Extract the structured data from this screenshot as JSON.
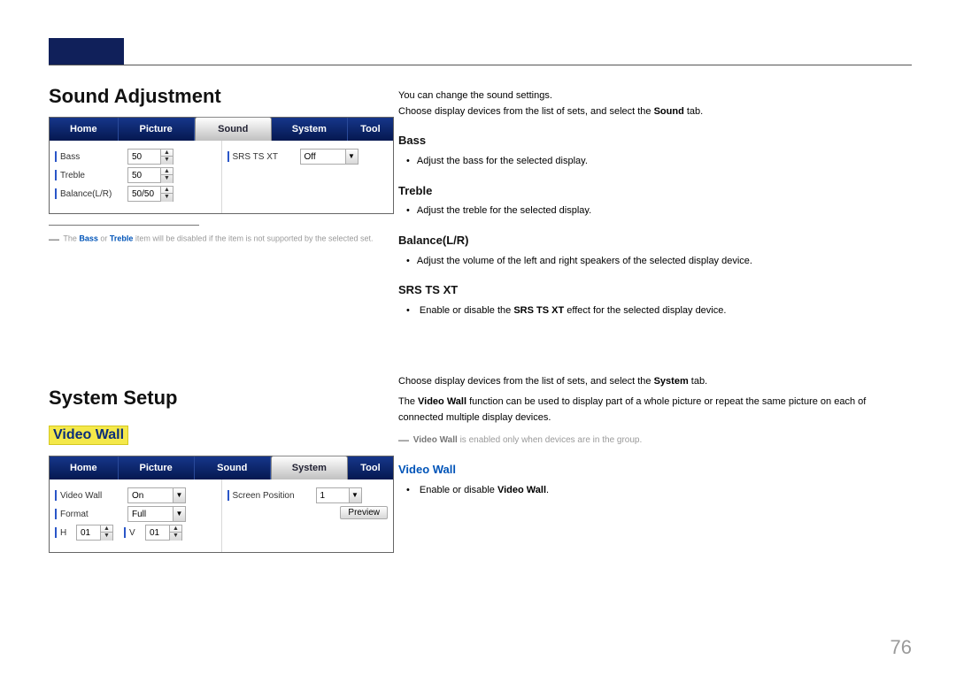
{
  "header": {
    "sound_title": "Sound Adjustment",
    "system_title": "System Setup",
    "video_wall_highlight": "Video Wall"
  },
  "tabs": {
    "home": "Home",
    "picture": "Picture",
    "sound": "Sound",
    "system": "System",
    "tool": "Tool"
  },
  "sound_ui": {
    "bass_label": "Bass",
    "bass_value": "50",
    "treble_label": "Treble",
    "treble_value": "50",
    "balance_label": "Balance(L/R)",
    "balance_value": "50/50",
    "srs_label": "SRS TS XT",
    "srs_value": "Off"
  },
  "system_ui": {
    "video_wall_label": "Video Wall",
    "video_wall_value": "On",
    "format_label": "Format",
    "format_value": "Full",
    "h_label": "H",
    "h_value": "01",
    "v_label": "V",
    "v_value": "01",
    "screen_pos_label": "Screen Position",
    "screen_pos_value": "1",
    "preview_label": "Preview"
  },
  "notes": {
    "sound_note_prefix": "The ",
    "sound_note_bass": "Bass",
    "sound_note_or": " or ",
    "sound_note_treble": "Treble",
    "sound_note_suffix": " item will be disabled if the item is not supported by the selected set.",
    "vw_note_prefix": "",
    "vw_note_bold": "Video Wall",
    "vw_note_suffix": " is enabled only when devices are in the group."
  },
  "right": {
    "intro1": "You can change the sound settings.",
    "intro2a": "Choose display devices from the list of sets, and select the ",
    "intro2b": "Sound",
    "intro2c": " tab.",
    "bass_h": "Bass",
    "bass_b": "Adjust the bass for the selected display.",
    "treble_h": "Treble",
    "treble_b": "Adjust the treble for the selected display.",
    "balance_h": "Balance(L/R)",
    "balance_b": "Adjust the volume of the left and right speakers of the selected display device.",
    "srs_h": "SRS TS XT",
    "srs_b1": "Enable or disable the ",
    "srs_b2": "SRS TS XT",
    "srs_b3": " effect for the selected display device.",
    "sys_intro_a": "Choose display devices from the list of sets, and select the ",
    "sys_intro_b": "System",
    "sys_intro_c": " tab.",
    "sys_desc_a": "The ",
    "sys_desc_b": "Video Wall",
    "sys_desc_c": " function can be used to display part of a whole picture or repeat the same picture on each of connected multiple display devices.",
    "vw_h": "Video Wall",
    "vw_b1": "Enable or disable ",
    "vw_b2": "Video Wall",
    "vw_b3": "."
  },
  "page_number": "76"
}
